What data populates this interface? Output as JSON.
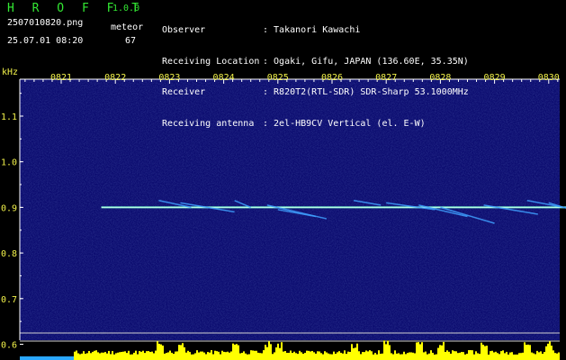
{
  "header": {
    "app_title": "H R O F F T",
    "app_version": "1.0.0",
    "file_name": "2507010820.png",
    "meteor_label": "meteor",
    "date_time": "25.07.01 08:20",
    "meteor_count": "67",
    "info": [
      {
        "label": "Observer",
        "value": ": Takanori Kawachi"
      },
      {
        "label": "Receiving Location",
        "value": ": Ogaki, Gifu, JAPAN (136.60E, 35.35N)"
      },
      {
        "label": "Receiver",
        "value": ": R820T2(RTL-SDR) SDR-Sharp 53.1000MHz"
      },
      {
        "label": "Receiving antenna",
        "value": ": 2el-HB9CV Vertical (el. E-W)"
      }
    ]
  },
  "colors": {
    "background": "#000000",
    "spectrogram_bg": "#0a0a6e",
    "header_text": "#ffffff",
    "title_green": "#33e833",
    "axis_yellow": "#f2f24a",
    "time_label": "#9ff5ff",
    "carrier_line": "#7fffd4",
    "meteor_trail": "#3fa0ff",
    "level_bars": "#ffff00"
  },
  "chart_data": {
    "type": "heatmap",
    "title": "",
    "xlabel": "",
    "ylabel": "kHz",
    "x_ticks": [
      "0821",
      "0822",
      "0823",
      "0824",
      "0825",
      "0826",
      "0827",
      "0828",
      "0829",
      "0830"
    ],
    "y_ticks": [
      "1.1",
      "1.0",
      "0.9",
      "0.8",
      "0.7",
      "0.6"
    ],
    "ylim": [
      0.58,
      1.2
    ],
    "carrier": {
      "freq": 0.9,
      "x_start": 0.74,
      "x_end": 9.67
    },
    "trails": [
      {
        "x0": 1.8,
        "f0": 0.915,
        "x1": 2.4,
        "f1": 0.9
      },
      {
        "x0": 2.2,
        "f0": 0.91,
        "x1": 3.2,
        "f1": 0.89
      },
      {
        "x0": 3.2,
        "f0": 0.915,
        "x1": 3.5,
        "f1": 0.9
      },
      {
        "x0": 3.8,
        "f0": 0.905,
        "x1": 4.9,
        "f1": 0.875
      },
      {
        "x0": 4.0,
        "f0": 0.895,
        "x1": 4.7,
        "f1": 0.88
      },
      {
        "x0": 5.4,
        "f0": 0.915,
        "x1": 5.9,
        "f1": 0.905
      },
      {
        "x0": 6.0,
        "f0": 0.91,
        "x1": 6.9,
        "f1": 0.895
      },
      {
        "x0": 6.6,
        "f0": 0.905,
        "x1": 7.5,
        "f1": 0.88
      },
      {
        "x0": 7.0,
        "f0": 0.9,
        "x1": 8.0,
        "f1": 0.865
      },
      {
        "x0": 7.8,
        "f0": 0.905,
        "x1": 8.8,
        "f1": 0.885
      },
      {
        "x0": 8.6,
        "f0": 0.915,
        "x1": 9.5,
        "f1": 0.895
      },
      {
        "x0": 9.0,
        "f0": 0.91,
        "x1": 9.7,
        "f1": 0.885
      }
    ],
    "grid": false
  }
}
